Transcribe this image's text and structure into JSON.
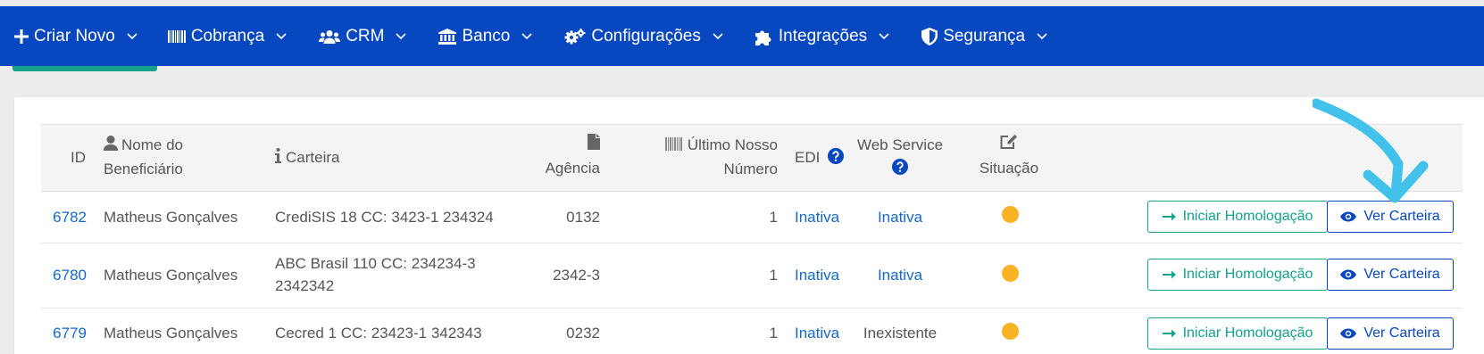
{
  "nav": {
    "items": [
      {
        "label": "Criar Novo",
        "icon": "plus-icon"
      },
      {
        "label": "Cobrança",
        "icon": "barcode-icon"
      },
      {
        "label": "CRM",
        "icon": "users-icon"
      },
      {
        "label": "Banco",
        "icon": "bank-icon"
      },
      {
        "label": "Configurações",
        "icon": "cogs-icon"
      },
      {
        "label": "Integrações",
        "icon": "puzzle-icon"
      },
      {
        "label": "Segurança",
        "icon": "shield-icon"
      }
    ]
  },
  "table": {
    "headers": {
      "id": "ID",
      "nome_l1": "Nome do",
      "nome_l2": "Beneficiário",
      "carteira": "Carteira",
      "agencia": "Agência",
      "ultimo_l1": "Último Nosso",
      "ultimo_l2": "Número",
      "edi": "EDI",
      "ws_l1": "Web Service",
      "situacao": "Situação"
    },
    "rows": [
      {
        "id": "6782",
        "nome": "Matheus Gonçalves",
        "carteira_l1": "CrediSIS 18 CC: 3423-1 234324",
        "carteira_l2": "",
        "agencia": "0132",
        "ultimo": "1",
        "edi": "Inativa",
        "ws": "Inativa",
        "situacao_color": "#fbb326"
      },
      {
        "id": "6780",
        "nome": "Matheus Gonçalves",
        "carteira_l1": "ABC Brasil 110 CC: 234234-3",
        "carteira_l2": "2342342",
        "agencia": "2342-3",
        "ultimo": "1",
        "edi": "Inativa",
        "ws": "Inativa",
        "situacao_color": "#fbb326"
      },
      {
        "id": "6779",
        "nome": "Matheus Gonçalves",
        "carteira_l1": "Cecred 1 CC: 23423-1 342343",
        "carteira_l2": "",
        "agencia": "0232",
        "ultimo": "1",
        "edi": "Inativa",
        "ws": "Inexistente",
        "situacao_color": "#fbb326"
      }
    ],
    "actions": {
      "homologacao": "Iniciar Homologação",
      "ver_carteira": "Ver Carteira"
    }
  },
  "colors": {
    "nav_bg": "#0747c0",
    "accent_green": "#16a28b",
    "link_blue": "#1668c8",
    "status_pending": "#fbb326",
    "annotation_arrow": "#42c2ea"
  }
}
